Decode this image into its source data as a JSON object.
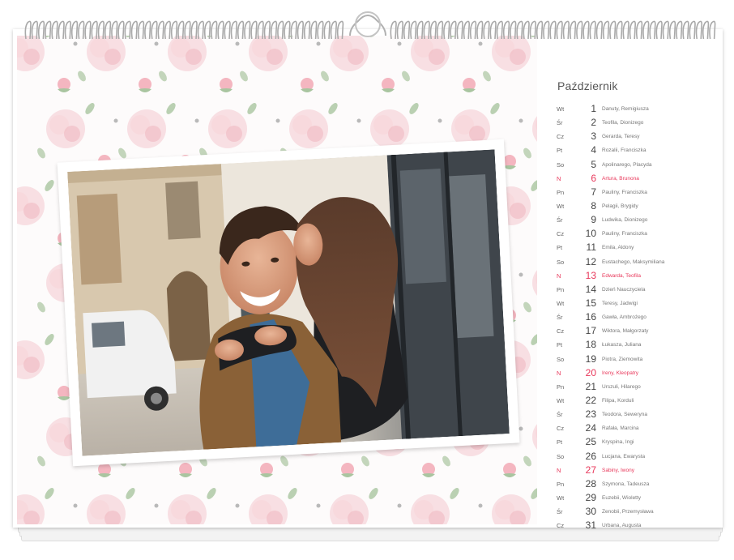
{
  "calendar": {
    "month": "Październik",
    "days": [
      {
        "dow": "Wt",
        "num": "1",
        "names": "Danuty, Remigiusza",
        "holiday": false
      },
      {
        "dow": "Śr",
        "num": "2",
        "names": "Teofila, Dionizego",
        "holiday": false
      },
      {
        "dow": "Cz",
        "num": "3",
        "names": "Gerarda, Teresy",
        "holiday": false
      },
      {
        "dow": "Pt",
        "num": "4",
        "names": "Rozalii, Franciszka",
        "holiday": false
      },
      {
        "dow": "So",
        "num": "5",
        "names": "Apolinarego, Placyda",
        "holiday": false
      },
      {
        "dow": "N",
        "num": "6",
        "names": "Artura, Brunona",
        "holiday": true
      },
      {
        "dow": "Pn",
        "num": "7",
        "names": "Pauliny, Franciszka",
        "holiday": false
      },
      {
        "dow": "Wt",
        "num": "8",
        "names": "Pelagii, Brygidy",
        "holiday": false
      },
      {
        "dow": "Śr",
        "num": "9",
        "names": "Ludwika, Dionizego",
        "holiday": false
      },
      {
        "dow": "Cz",
        "num": "10",
        "names": "Pauliny, Franciszka",
        "holiday": false
      },
      {
        "dow": "Pt",
        "num": "11",
        "names": "Emila, Aldony",
        "holiday": false
      },
      {
        "dow": "So",
        "num": "12",
        "names": "Eustachego, Maksymiliana",
        "holiday": false
      },
      {
        "dow": "N",
        "num": "13",
        "names": "Edwarda, Teofila",
        "holiday": true
      },
      {
        "dow": "Pn",
        "num": "14",
        "names": "Dzień Nauczyciela",
        "holiday": false
      },
      {
        "dow": "Wt",
        "num": "15",
        "names": "Teresy, Jadwigi",
        "holiday": false
      },
      {
        "dow": "Śr",
        "num": "16",
        "names": "Gawła, Ambrożego",
        "holiday": false
      },
      {
        "dow": "Cz",
        "num": "17",
        "names": "Wiktora, Małgorzaty",
        "holiday": false
      },
      {
        "dow": "Pt",
        "num": "18",
        "names": "Łukasza, Juliana",
        "holiday": false
      },
      {
        "dow": "So",
        "num": "19",
        "names": "Piotra, Ziemowita",
        "holiday": false
      },
      {
        "dow": "N",
        "num": "20",
        "names": "Ireny, Kleopatry",
        "holiday": true
      },
      {
        "dow": "Pn",
        "num": "21",
        "names": "Urszuli, Hilarego",
        "holiday": false
      },
      {
        "dow": "Wt",
        "num": "22",
        "names": "Filipa, Korduli",
        "holiday": false
      },
      {
        "dow": "Śr",
        "num": "23",
        "names": "Teodora, Seweryna",
        "holiday": false
      },
      {
        "dow": "Cz",
        "num": "24",
        "names": "Rafała, Marcina",
        "holiday": false
      },
      {
        "dow": "Pt",
        "num": "25",
        "names": "Kryspina, Ingi",
        "holiday": false
      },
      {
        "dow": "So",
        "num": "26",
        "names": "Lucjana, Ewarysta",
        "holiday": false
      },
      {
        "dow": "N",
        "num": "27",
        "names": "Sabiny, Iwony",
        "holiday": true
      },
      {
        "dow": "Pn",
        "num": "28",
        "names": "Szymona, Tadeusza",
        "holiday": false
      },
      {
        "dow": "Wt",
        "num": "29",
        "names": "Euzebii, Wioletty",
        "holiday": false
      },
      {
        "dow": "Śr",
        "num": "30",
        "names": "Zenobii, Przemysława",
        "holiday": false
      },
      {
        "dow": "Cz",
        "num": "31",
        "names": "Urbana, Augusta",
        "holiday": false
      }
    ]
  },
  "colors": {
    "holiday": "#e8375a",
    "pattern_rose": "#f4c9cf",
    "pattern_leaf": "#a9c5a0"
  },
  "icons": {
    "binding": "spiral-binding-icon",
    "hanger": "hanger-hook-icon",
    "flower": "rose-pattern-icon",
    "photo": "couple-photo"
  }
}
